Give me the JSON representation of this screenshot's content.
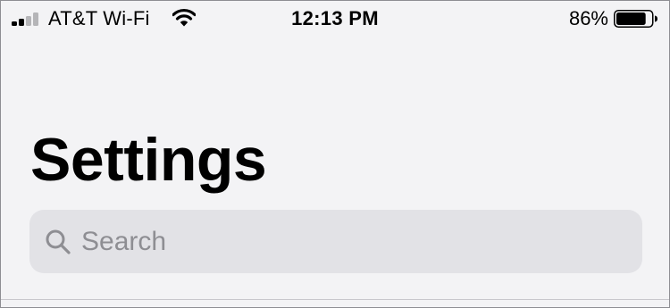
{
  "status_bar": {
    "carrier": "AT&T Wi-Fi",
    "time": "12:13 PM",
    "battery_percent": "86%",
    "battery_level": 0.86,
    "signal_bars_total": 4,
    "signal_bars_active": 2,
    "icons": [
      "signal-bars-icon",
      "wifi-icon",
      "battery-icon"
    ]
  },
  "header": {
    "title": "Settings"
  },
  "search": {
    "placeholder": "Search",
    "value": "",
    "icon": "search-icon"
  },
  "colors": {
    "background": "#f3f3f5",
    "search_field": "#e2e2e6",
    "placeholder": "#8e8e93",
    "text": "#000000"
  }
}
